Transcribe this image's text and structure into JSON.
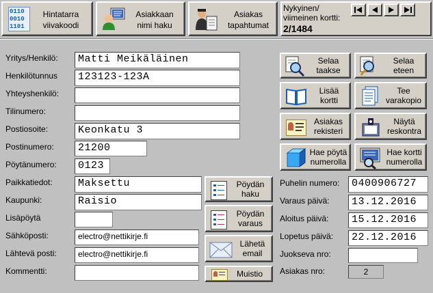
{
  "toolbar": {
    "barcode_label": "Hintatarra\nviivakoodi",
    "barcode_icon_text": "0110\n0010\n1101",
    "customer_search_label": "Asiakkaan\nnimi haku",
    "customer_events_label": "Asiakas\ntapahtumat"
  },
  "record": {
    "label": "Nykyinen/\nviimeinen kortti:",
    "value": "2/1484"
  },
  "fields": {
    "company_label": "Yritys/Henkilö:",
    "company_value": "Matti Meikäläinen",
    "id_label": "Henkilötunnus",
    "id_value": "123123-123A",
    "contact_label": "Yhteyshenkilö:",
    "contact_value": "",
    "account_label": "Tilinumero:",
    "account_value": "",
    "address_label": "Postiosoite:",
    "address_value": "Keonkatu 3",
    "postal_label": "Postinumero:",
    "postal_value": "21200",
    "table_label": "Pöytänumero:",
    "table_value": "0123",
    "location_label": "Paikkatiedot:",
    "location_value": "Maksettu",
    "city_label": "Kaupunki:",
    "city_value": "Raisio",
    "extra_table_label": "Lisäpöytä",
    "extra_table_value": "",
    "email_label": "Sähköposti:",
    "email_value": "electro@nettikirje.fi",
    "out_mail_label": "Lähtevä posti:",
    "out_mail_value": "electro@nettikirje.fi",
    "comments_label": "Kommentti:",
    "comments_value": ""
  },
  "mid_buttons": {
    "table_search": "Pöydän\nhaku",
    "table_booking": "Pöydän\nvaraus",
    "send_email": "Lähetä\nemail",
    "memo": "Muistio"
  },
  "right_buttons": {
    "browse_back": "Selaa\ntaakse",
    "browse_forward": "Selaa\neteen",
    "add_card": "Lisää\nkortti",
    "backup": "Tee\nvarakopio",
    "customer_register": "Asiakas\nrekisteri",
    "show_register": "Näytä\nreskontra",
    "find_table": "Hae pöytä\nnumerolla",
    "find_card": "Hae kortti\nnumerolla"
  },
  "right_fields": {
    "phone_label": "Puhelin numero:",
    "phone_value": "0400906727",
    "booking_date_label": "Varaus päivä:",
    "booking_date_value": "13.12.2016",
    "start_date_label": "Aloitus päivä:",
    "start_date_value": "15.12.2016",
    "end_date_label": "Lopetus päivä:",
    "end_date_value": "22.12.2016",
    "running_no_label": "Juokseva nro:",
    "running_no_value": "",
    "customer_no_label": "Asiakas nro:",
    "customer_no_value": "2"
  },
  "colors": {
    "window_bg": "#c0c0c0",
    "button_face": "#d4d0c8",
    "field_bg": "#ffffff",
    "icon_blue": "#1a5fb4"
  }
}
